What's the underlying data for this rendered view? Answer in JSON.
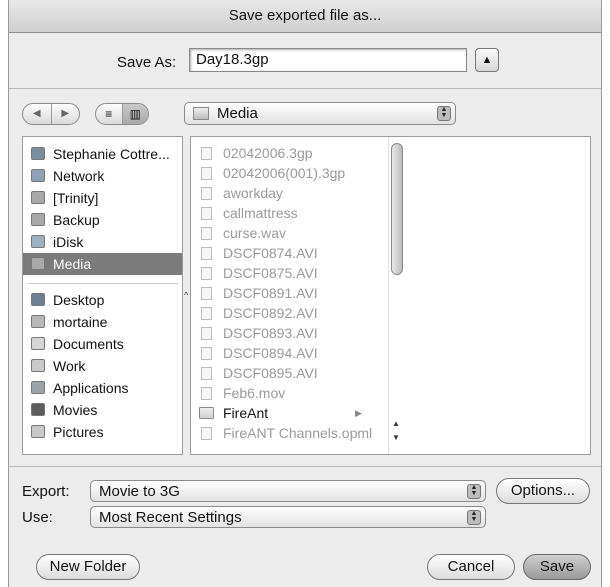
{
  "window": {
    "title": "Save exported file as..."
  },
  "save_as": {
    "label": "Save As:",
    "value": "Day18.3gp"
  },
  "toolbar": {
    "back_glyph": "◀",
    "forward_glyph": "▶",
    "list_view_glyph": "≡",
    "column_view_glyph": "▥",
    "location": "Media",
    "expand_glyph": "▲"
  },
  "sidebar": {
    "devices": [
      {
        "label": "Stephanie Cottre...",
        "icon": "computer-icon"
      },
      {
        "label": "Network",
        "icon": "network-globe-icon"
      },
      {
        "label": "[Trinity]",
        "icon": "drive-icon"
      },
      {
        "label": "Backup",
        "icon": "drive-icon"
      },
      {
        "label": "iDisk",
        "icon": "idisk-icon"
      },
      {
        "label": "Media",
        "icon": "drive-icon",
        "selected": true
      }
    ],
    "places": [
      {
        "label": "Desktop",
        "icon": "desktop-icon"
      },
      {
        "label": "mortaine",
        "icon": "home-icon"
      },
      {
        "label": "Documents",
        "icon": "documents-icon"
      },
      {
        "label": "Work",
        "icon": "folder-icon"
      },
      {
        "label": "Applications",
        "icon": "applications-icon"
      },
      {
        "label": "Movies",
        "icon": "movies-icon"
      },
      {
        "label": "Pictures",
        "icon": "pictures-icon"
      }
    ]
  },
  "browser": {
    "files": [
      {
        "name": "02042006.3gp",
        "enabled": false
      },
      {
        "name": "02042006(001).3gp",
        "enabled": false
      },
      {
        "name": "aworkday",
        "enabled": false
      },
      {
        "name": "callmattress",
        "enabled": false
      },
      {
        "name": "curse.wav",
        "enabled": false
      },
      {
        "name": "DSCF0874.AVI",
        "enabled": false
      },
      {
        "name": "DSCF0875.AVI",
        "enabled": false
      },
      {
        "name": "DSCF0891.AVI",
        "enabled": false
      },
      {
        "name": "DSCF0892.AVI",
        "enabled": false
      },
      {
        "name": "DSCF0893.AVI",
        "enabled": false
      },
      {
        "name": "DSCF0894.AVI",
        "enabled": false
      },
      {
        "name": "DSCF0895.AVI",
        "enabled": false
      },
      {
        "name": "Feb6.mov",
        "enabled": false
      },
      {
        "name": "FireAnt",
        "enabled": true,
        "folder": true
      },
      {
        "name": "FireANT Channels.opml",
        "enabled": false
      }
    ]
  },
  "export": {
    "label": "Export:",
    "value": "Movie to 3G",
    "options_label": "Options...",
    "use_label": "Use:",
    "use_value": "Most Recent Settings"
  },
  "buttons": {
    "new_folder": "New Folder",
    "cancel": "Cancel",
    "save": "Save"
  },
  "colors": {
    "selection": "#7b7b7b",
    "default_button": "#a8a8a8"
  }
}
